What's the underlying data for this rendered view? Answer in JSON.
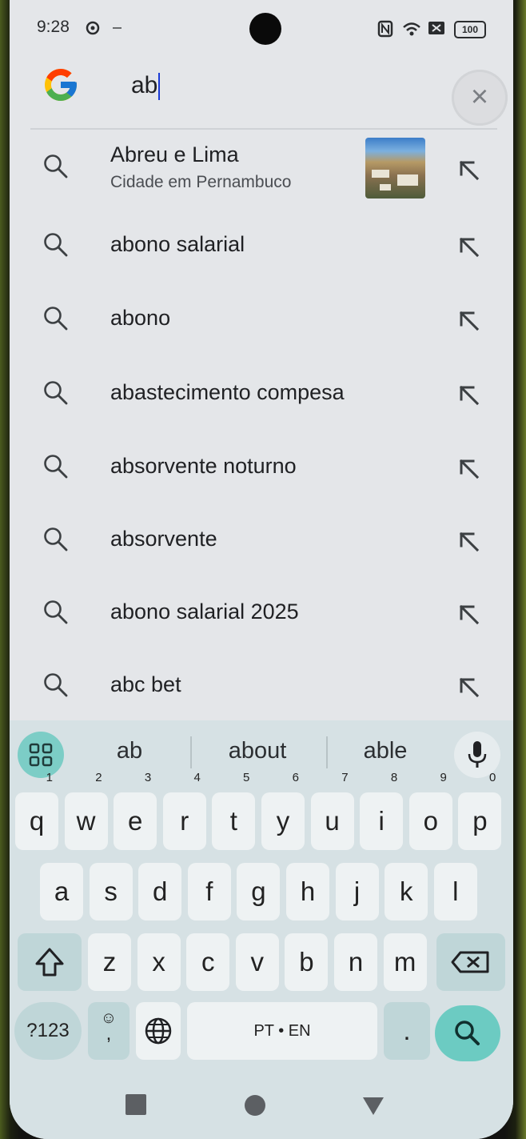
{
  "status_bar": {
    "time": "9:28",
    "battery": "100",
    "icons": [
      "settings-icon",
      "minus-icon",
      "nfc-icon",
      "wifi-icon",
      "sim-icon",
      "battery-icon"
    ]
  },
  "search": {
    "query": "ab",
    "clear_icon": "close-icon",
    "logo": "google-logo"
  },
  "suggestions": [
    {
      "text": "Abreu e Lima",
      "subtitle": "Cidade em Pernambuco",
      "has_thumbnail": true
    },
    {
      "text": "abono salarial"
    },
    {
      "text": "abono"
    },
    {
      "text": "abastecimento compesa"
    },
    {
      "text": "absorvente noturno"
    },
    {
      "text": "absorvente"
    },
    {
      "text": "abono salarial 2025"
    },
    {
      "text": "abc bet"
    }
  ],
  "keyboard": {
    "word_suggestions": [
      "ab",
      "about",
      "able"
    ],
    "row1": [
      {
        "l": "q",
        "n": "1"
      },
      {
        "l": "w",
        "n": "2"
      },
      {
        "l": "e",
        "n": "3"
      },
      {
        "l": "r",
        "n": "4"
      },
      {
        "l": "t",
        "n": "5"
      },
      {
        "l": "y",
        "n": "6"
      },
      {
        "l": "u",
        "n": "7"
      },
      {
        "l": "i",
        "n": "8"
      },
      {
        "l": "o",
        "n": "9"
      },
      {
        "l": "p",
        "n": "0"
      }
    ],
    "row2": [
      "a",
      "s",
      "d",
      "f",
      "g",
      "h",
      "j",
      "k",
      "l"
    ],
    "row3": [
      "z",
      "x",
      "c",
      "v",
      "b",
      "n",
      "m"
    ],
    "symbols_label": "?123",
    "comma_label": ",",
    "space_label": "PT • EN",
    "period_label": ".",
    "accent_color": "#6ccbc2"
  },
  "nav_bar": {
    "icons": [
      "recents-square-icon",
      "home-circle-icon",
      "back-triangle-icon"
    ]
  }
}
